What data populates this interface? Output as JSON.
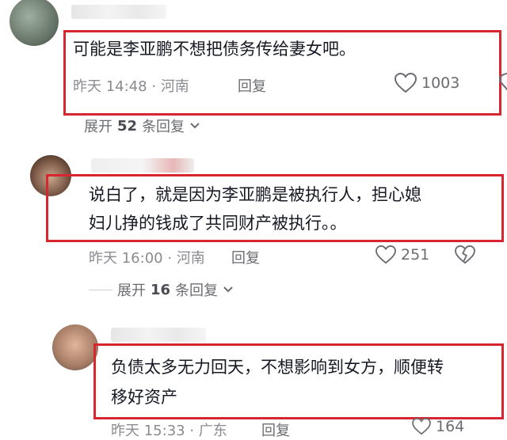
{
  "comments": [
    {
      "text": "可能是李亚鹏不想把债务传给妻女吧。",
      "time": "昨天 14:48",
      "location": "河南",
      "reply_label": "回复",
      "likes": "1003"
    },
    {
      "text_line1": "说白了，就是因为李亚鹏是被执行人，担心媳",
      "text_line2": "妇儿挣的钱成了共同财产被执行。。",
      "time": "昨天 16:00",
      "location": "河南",
      "reply_label": "回复",
      "likes": "251"
    },
    {
      "text_line1": "负债太多无力回天，不想影响到女方，顺便转",
      "text_line2": "移好资产",
      "time": "昨天 15:33",
      "location": "广东",
      "reply_label": "回复",
      "likes": "164"
    }
  ],
  "expand_1": {
    "prefix": "展开",
    "count": "52",
    "suffix": "条回复"
  },
  "expand_2": {
    "prefix": "展开",
    "count": "16",
    "suffix": "条回复"
  },
  "dot": "·",
  "colors": {
    "highlight": "#d7262f",
    "meta": "#8a8b91"
  }
}
